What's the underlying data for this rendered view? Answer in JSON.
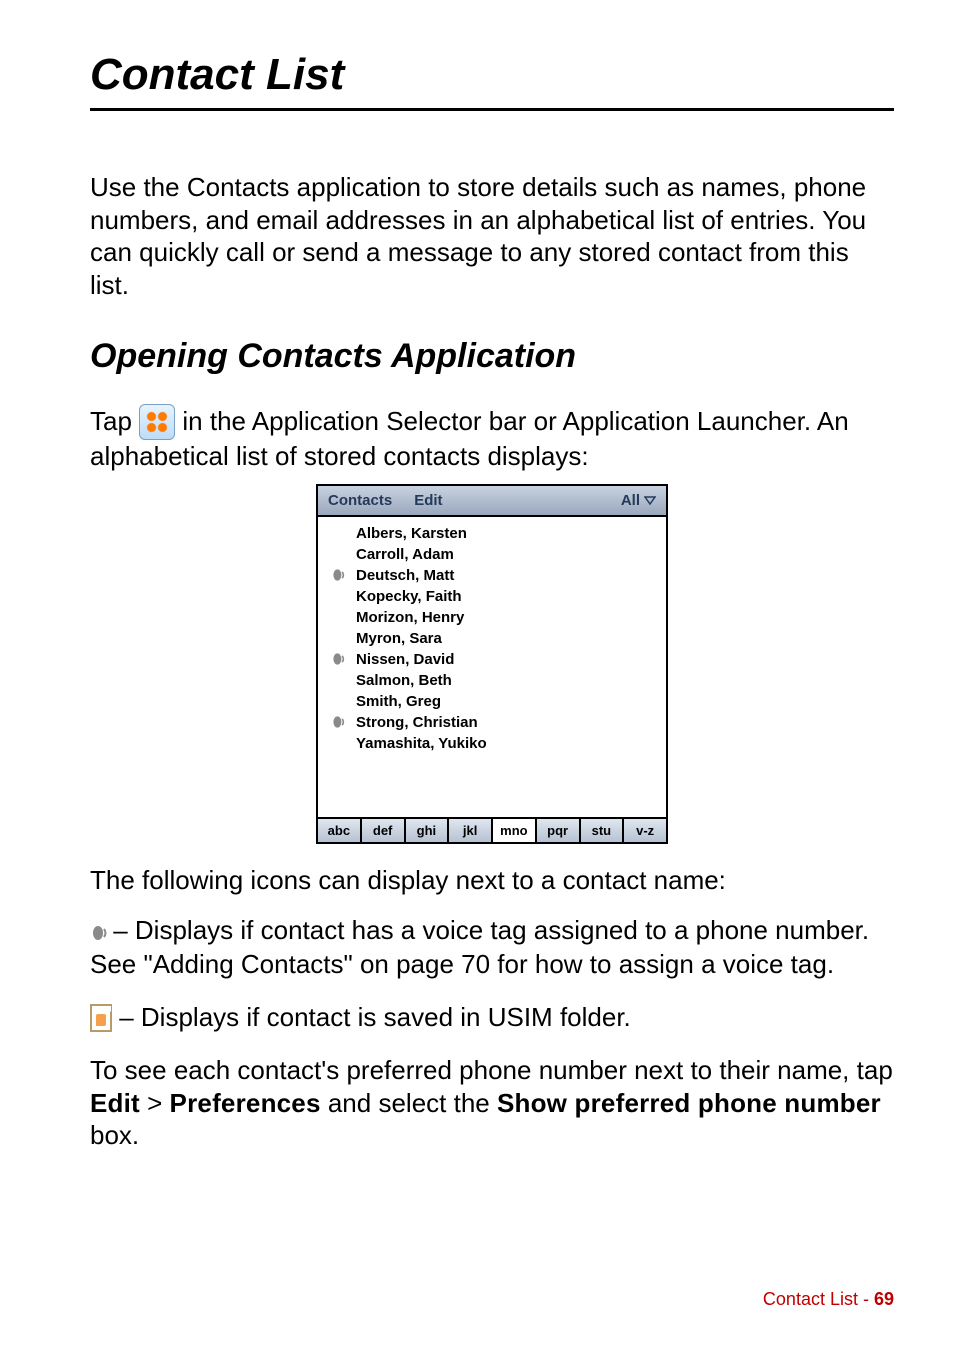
{
  "title": "Contact List",
  "intro": "Use the Contacts application to store details such as names, phone numbers, and email addresses in an alphabetical list of entries. You can quickly call or send a message to any stored contact from this list.",
  "section_heading": "Opening Contacts Application",
  "open_para_pre": "Tap ",
  "open_para_post": " in the Application Selector bar or Application Launcher. An alphabetical list of stored contacts displays:",
  "screenshot": {
    "menu_contacts": "Contacts",
    "menu_edit": "Edit",
    "filter_label": "All",
    "entries": [
      {
        "name": "Albers, Karsten",
        "voice": false
      },
      {
        "name": "Carroll, Adam",
        "voice": false
      },
      {
        "name": "Deutsch, Matt",
        "voice": true
      },
      {
        "name": "Kopecky, Faith",
        "voice": false
      },
      {
        "name": "Morizon, Henry",
        "voice": false
      },
      {
        "name": "Myron, Sara",
        "voice": false
      },
      {
        "name": "Nissen, David",
        "voice": true
      },
      {
        "name": "Salmon, Beth",
        "voice": false
      },
      {
        "name": "Smith, Greg",
        "voice": false
      },
      {
        "name": "Strong, Christian",
        "voice": true
      },
      {
        "name": "Yamashita, Yukiko",
        "voice": false
      }
    ],
    "tabs": [
      "abc",
      "def",
      "ghi",
      "jkl",
      "mno",
      "pqr",
      "stu",
      "v-z"
    ],
    "active_tab_index": 4
  },
  "icons_intro": "The following icons can display next to a contact name:",
  "voice_icon_desc": " – Displays if contact has a voice tag assigned to a phone number. See \"Adding Contacts\" on page 70 for how to assign a voice tag.",
  "sim_icon_desc": " – Displays if contact is saved in USIM folder.",
  "pref_para_pre": "To see each contact's preferred phone number next to their name, tap ",
  "pref_edit": "Edit",
  "pref_gt": " > ",
  "pref_preferences": "Preferences",
  "pref_mid": " and select the ",
  "pref_show": "Show preferred phone number",
  "pref_end": " box.",
  "footer_label": "Contact List - ",
  "footer_page": "69"
}
